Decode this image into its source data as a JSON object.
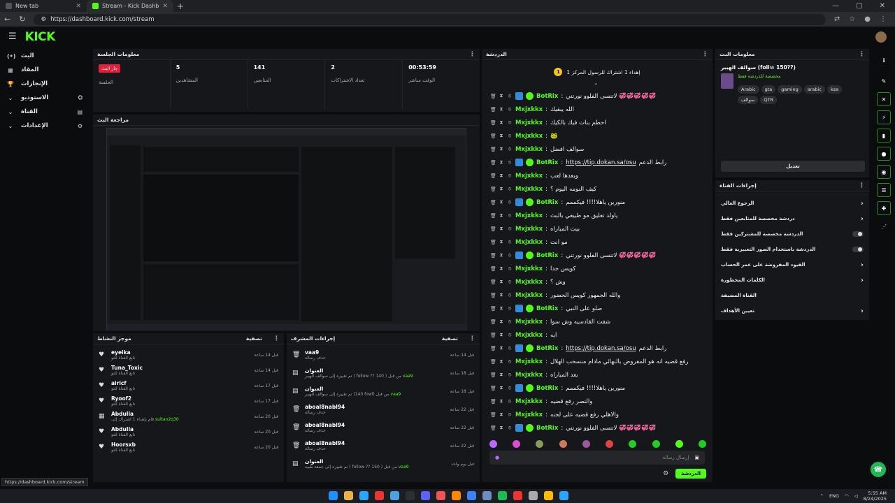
{
  "browser": {
    "tabs": [
      {
        "title": "New tab"
      },
      {
        "title": "Stream - Kick Dashboard"
      }
    ],
    "url": "https://dashboard.kick.com/stream",
    "hover_url": "https://dashboard.kick.com/stream"
  },
  "brand": {
    "logo": "KICK",
    "accent": "#53fc18"
  },
  "sidebar": {
    "items": [
      {
        "label": "البث",
        "icon": "(•)"
      },
      {
        "label": "المقاد",
        "icon": "▦"
      },
      {
        "label": "الإنجازات",
        "icon": "🏆"
      },
      {
        "label": "الاستوديو",
        "icon": "⌄"
      },
      {
        "label": "القناة",
        "icon": "⌄"
      },
      {
        "label": "الإعدادات",
        "icon": "⌄"
      }
    ]
  },
  "session": {
    "title": "معلومات الجلسة",
    "live_badge": "جار البث",
    "stats": [
      {
        "value": "",
        "label": "الجلسة"
      },
      {
        "value": "5",
        "label": "المشاهدين"
      },
      {
        "value": "141",
        "label": "المتابعين"
      },
      {
        "value": "2",
        "label": "تعداد الاشتراكات"
      },
      {
        "value": "00:53:59",
        "label": "الوقت مباشر"
      }
    ]
  },
  "preview": {
    "title": "مراجعة البث"
  },
  "activity": {
    "title": "موجز النشاط",
    "filter": "تصفية",
    "items": [
      {
        "name": "eyeika",
        "sub": "تابع القناة للتو",
        "time": "قبل 14 ساعة"
      },
      {
        "name": "Tuna_Toxic",
        "sub": "تابع القناة للتو",
        "time": "قبل 14 ساعة"
      },
      {
        "name": "airicf",
        "sub": "تابع القناة للتو",
        "time": "قبل 17 ساعة"
      },
      {
        "name": "Ryoof2",
        "sub": "تابع القناة للتو",
        "time": "قبل 17 ساعة"
      },
      {
        "name": "Abdulla",
        "sub": "قام بإهداء 1 اشتراك إلى",
        "extra": "sultan2q30",
        "time": "قبل 20 ساعة"
      },
      {
        "name": "Abdulla",
        "sub": "تابع القناة للتو",
        "time": "قبل 20 ساعة"
      },
      {
        "name": "Hoorsxb",
        "sub": "تابع القناة للتو",
        "time": "قبل 20 ساعة"
      }
    ]
  },
  "modactions": {
    "title": "إجراءات المشرف",
    "filter": "تصفية",
    "items": [
      {
        "name": "vaa9",
        "sub": "حذف رسالة",
        "time": "قبل 14 ساعة"
      },
      {
        "name": "العنوان",
        "sub": "تم تغييره إلى سوالف الهيبر ( follow ?? 140 ) من قبل",
        "extra": "vaa9",
        "time": "قبل 18 ساعة"
      },
      {
        "name": "العنوان",
        "sub": "تم تغييره إلى سوالف الهيبر (140 fowl) من قبل",
        "extra": "vaa9",
        "time": "قبل 18 ساعة"
      },
      {
        "name": "aboal8nabl94",
        "sub": "حذف رسالة",
        "time": "قبل 22 ساعة"
      },
      {
        "name": "aboal8nabl94",
        "sub": "حذف رسالة",
        "time": "قبل 22 ساعة"
      },
      {
        "name": "aboal8nabl94",
        "sub": "حذف رسالة",
        "time": "قبل 22 ساعة"
      },
      {
        "name": "العنوان",
        "sub": "تم تغييره إلى جمعة طيبه ( follow ?? 150 ) من قبل",
        "extra": "vaa9",
        "time": "قبل يوم واحد"
      }
    ]
  },
  "chat": {
    "title": "الدردشة",
    "pinned": "إهداء 1 اشتراك للرسول المركز 1",
    "messages": [
      {
        "user": "BotRix",
        "color": "#53fc18",
        "body": "لاتنسى الفلوو نورتني 💞💞💞💞💞",
        "link": false
      },
      {
        "user": "Mxjxkkx",
        "color": "#53fc18",
        "body": "الله يبقيك",
        "link": false
      },
      {
        "user": "Mxjxkkx",
        "color": "#53fc18",
        "body": "احطم بنات فيك بالكيك",
        "link": false
      },
      {
        "user": "Mxjxkkx",
        "color": "#53fc18",
        "body": "🐸",
        "link": false
      },
      {
        "user": "Mxjxkkx",
        "color": "#53fc18",
        "body": "سوالف افضل",
        "link": false
      },
      {
        "user": "BotRix",
        "color": "#53fc18",
        "body": "https://tip.dokan.sa/osu",
        "pre": "رابط الدعم",
        "link": true
      },
      {
        "user": "Mxjxkkx",
        "color": "#53fc18",
        "body": "وبعدها لعب",
        "link": false
      },
      {
        "user": "Mxjxkkx",
        "color": "#53fc18",
        "body": "كيف النومه اليوم ؟",
        "link": false
      },
      {
        "user": "BotRix",
        "color": "#53fc18",
        "body": "منورين ياهلا!!!! فيكممم",
        "link": false
      },
      {
        "user": "Mxjxkkx",
        "color": "#53fc18",
        "body": "ياولد تعليق مو طبيعي بالبث",
        "link": false
      },
      {
        "user": "Mxjxkkx",
        "color": "#53fc18",
        "body": "بيث المباراه",
        "link": false
      },
      {
        "user": "Mxjxkkx",
        "color": "#53fc18",
        "body": "مو انت",
        "link": false
      },
      {
        "user": "BotRix",
        "color": "#53fc18",
        "body": "لاتنسى الفلوو نورتني 💞💞💞💞💞",
        "link": false
      },
      {
        "user": "Mxjxkkx",
        "color": "#53fc18",
        "body": "كويس جدا",
        "link": false
      },
      {
        "user": "Mxjxkkx",
        "color": "#53fc18",
        "body": "وش ؟",
        "link": false
      },
      {
        "user": "Mxjxkkx",
        "color": "#53fc18",
        "body": "والله الجمهور كويس الحضور",
        "link": false
      },
      {
        "user": "BotRix",
        "color": "#53fc18",
        "body": "صلو على النبي",
        "link": false
      },
      {
        "user": "Mxjxkkx",
        "color": "#53fc18",
        "body": "شفت القادسيه وش سوا",
        "link": false
      },
      {
        "user": "Mxjxkkx",
        "color": "#53fc18",
        "body": "ايه",
        "link": false
      },
      {
        "user": "BotRix",
        "color": "#53fc18",
        "body": "https://tip.dokan.sa/osu",
        "pre": "رابط الدعم",
        "link": true
      },
      {
        "user": "Mxjxkkx",
        "color": "#53fc18",
        "body": "رفع قضيه انه هو المفروض بالنهائي مادام منسحب الهلال",
        "link": false
      },
      {
        "user": "Mxjxkkx",
        "color": "#53fc18",
        "body": "بعد المباراه",
        "link": false
      },
      {
        "user": "BotRix",
        "color": "#53fc18",
        "body": "منورين ياهلا!!!! فيكممم",
        "link": false
      },
      {
        "user": "Mxjxkkx",
        "color": "#53fc18",
        "body": "والنصر رفع قضيه",
        "link": false
      },
      {
        "user": "Mxjxkkx",
        "color": "#53fc18",
        "body": "والاهلي رفع قضيه على لجنه",
        "link": false
      },
      {
        "user": "BotRix",
        "color": "#53fc18",
        "body": "لاتنسى الفلوو نورتني 💞💞💞💞💞",
        "link": false
      }
    ],
    "input_placeholder": "إرسال رسالة",
    "send_label": "الدردشة"
  },
  "streaminfo": {
    "title": "معلومات البث",
    "stream_title": "سوالف الهيبر (foll𝕨 150??)",
    "category": "مخصصة للدردشة فقط",
    "tags": [
      "Arabic",
      "gta",
      "gaming",
      "arabic",
      "ksa",
      "سوالف",
      "QTR"
    ],
    "edit_label": "تعديل"
  },
  "channelactions": {
    "title": "إجراءات القناة",
    "items": [
      {
        "label": "الرجوع العالي",
        "kind": "chevron"
      },
      {
        "label": "دردشة مخصصة للمتابعين فقط",
        "kind": "chevron"
      },
      {
        "label": "الدردشة مخصصة للمشتركين فقط",
        "kind": "toggle"
      },
      {
        "label": "الدردشة باستخدام الصور التعبيرية فقط",
        "kind": "toggle"
      },
      {
        "label": "القيود المفروضة على عمر الحساب",
        "kind": "chevron"
      },
      {
        "label": "الكلمات المحظورة",
        "kind": "chevron"
      },
      {
        "label": "القناة المضيفة",
        "kind": "none"
      },
      {
        "label": "تعيين الأهداف",
        "kind": "chevron"
      }
    ]
  },
  "taskbar": {
    "lang": "ENG",
    "time": "5:55 AM",
    "date": "8/24/2025"
  }
}
